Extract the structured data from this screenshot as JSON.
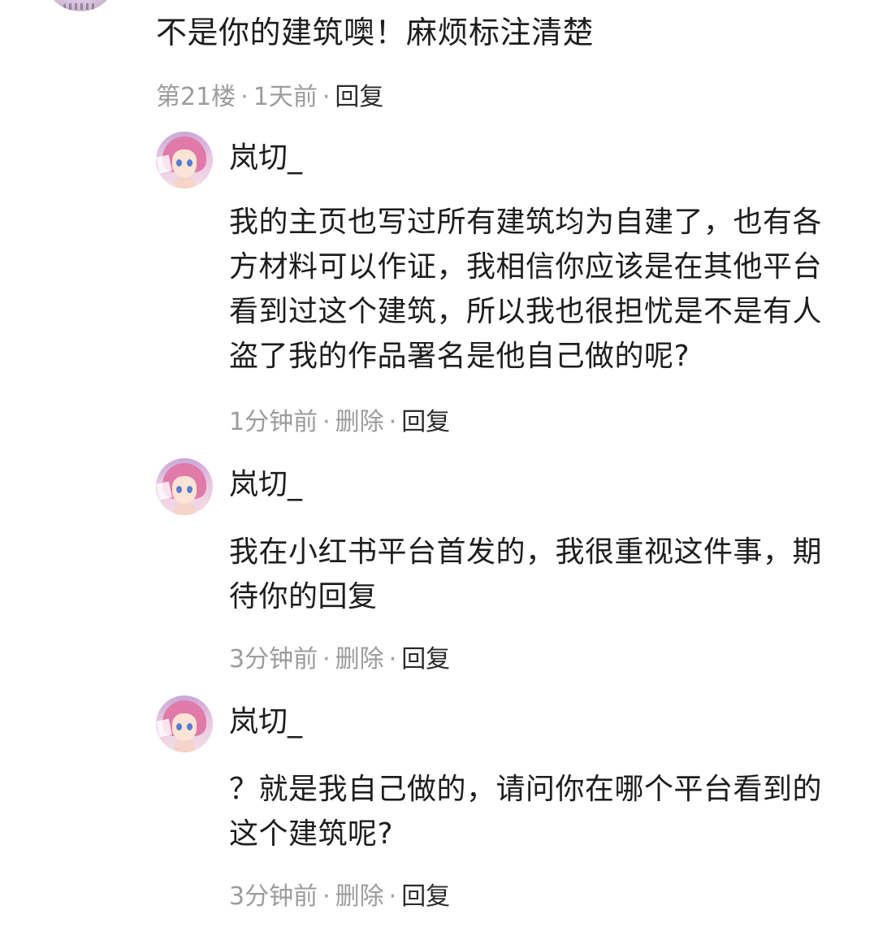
{
  "parent_comment": {
    "text": "不是你的建筑噢！麻烦标注清楚",
    "floor": "第21楼",
    "time": "1天前",
    "reply_label": "回复"
  },
  "replies": [
    {
      "username": "岚切_",
      "text": "我的主页也写过所有建筑均为自建了，也有各方材料可以作证，我相信你应该是在其他平台看到过这个建筑，所以我也很担忧是不是有人盗了我的作品署名是他自己做的呢?",
      "time": "1分钟前",
      "delete_label": "删除",
      "reply_label": "回复"
    },
    {
      "username": "岚切_",
      "text": "我在小红书平台首发的，我很重视这件事，期待你的回复",
      "time": "3分钟前",
      "delete_label": "删除",
      "reply_label": "回复"
    },
    {
      "username": "岚切_",
      "text": "？就是我自己做的，请问你在哪个平台看到的这个建筑呢?",
      "time": "3分钟前",
      "delete_label": "删除",
      "reply_label": "回复"
    }
  ],
  "separator": "·",
  "icons": {
    "parent_avatar": "user-avatar-icon",
    "reply_avatar": "anime-girl-avatar-icon"
  }
}
